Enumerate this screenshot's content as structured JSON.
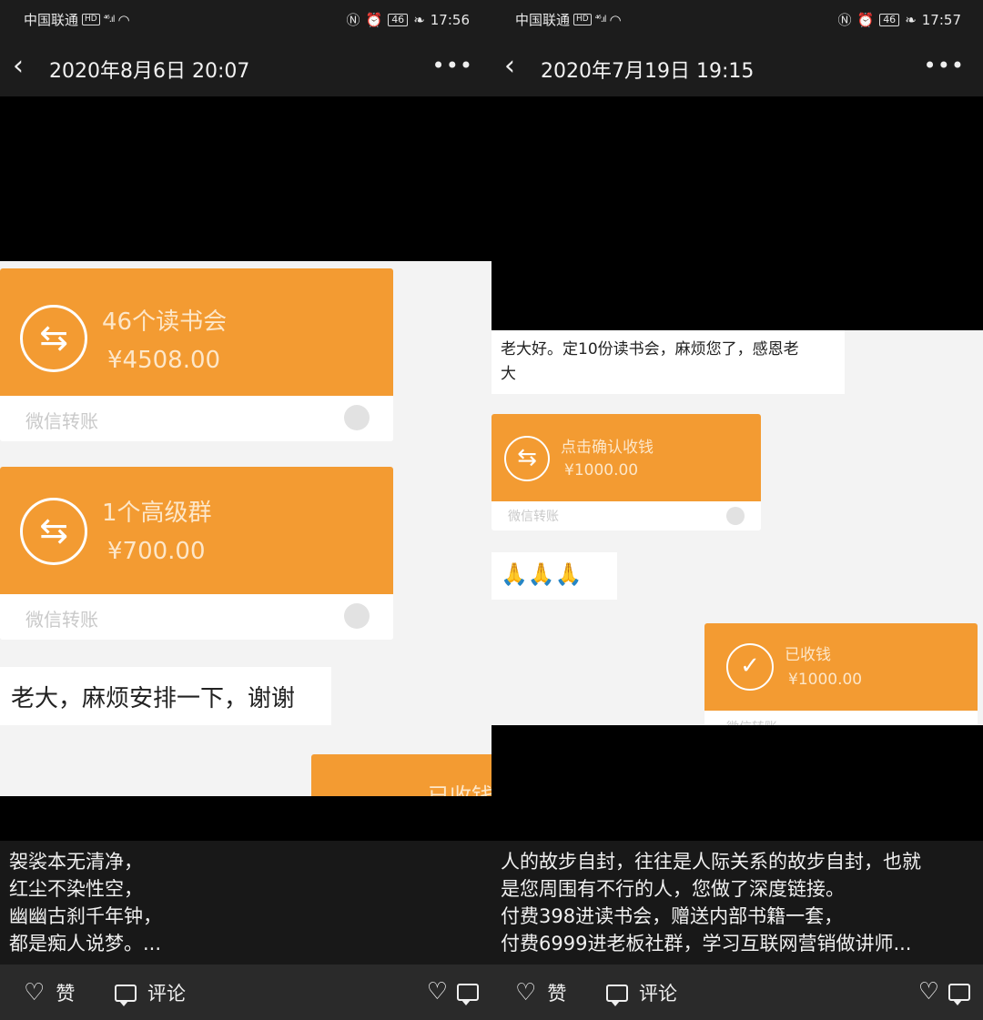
{
  "left": {
    "status": {
      "carrier": "中国联通",
      "hd": "HD",
      "network": "⁴⁶",
      "battery": "46",
      "time": "17:56"
    },
    "nav": {
      "title": "2020年8月6日 20:07"
    },
    "chat": {
      "transfer1": {
        "name": "46个读书会",
        "amount": "¥4508.00",
        "label": "微信转账"
      },
      "transfer2": {
        "name": "1个高级群",
        "amount": "¥700.00",
        "label": "微信转账"
      },
      "message": "老大，麻烦安排一下，谢谢",
      "partial_card": "已收钱"
    },
    "caption": [
      "袈裟本无清净，",
      "红尘不染性空，",
      "幽幽古刹千年钟，",
      "都是痴人说梦。..."
    ],
    "actions": {
      "like": "赞",
      "comment": "评论"
    }
  },
  "right": {
    "status": {
      "carrier": "中国联通",
      "hd": "HD",
      "network": "⁴⁶",
      "battery": "46",
      "time": "17:57"
    },
    "nav": {
      "title": "2020年7月19日 19:15"
    },
    "chat": {
      "message_line1": "老大好。定10份读书会，麻烦您了，感恩老",
      "message_line2": "大",
      "transfer1": {
        "name": "点击确认收钱",
        "amount": "¥1000.00",
        "label": "微信转账"
      },
      "emoji": "🙏🙏🙏",
      "transfer2": {
        "name": "已收钱",
        "amount": "¥1000.00",
        "label": "微信转账"
      }
    },
    "caption": [
      "人的故步自封，往往是人际关系的故步自封，也就",
      "是您周围有不行的人，您做了深度链接。",
      "付费398进读书会，赠送内部书籍一套，",
      "付费6999进老板社群，学习互联网营销做讲师..."
    ],
    "actions": {
      "like": "赞",
      "comment": "评论"
    }
  },
  "colors": {
    "transfer_orange": "#f39b32",
    "bar_dark": "#1c1c1c",
    "action_bar": "#2a2a2a"
  },
  "icons": {
    "back": "chevron-left-icon",
    "more": "more-dots-icon",
    "heart": "heart-icon",
    "comment": "comment-icon",
    "transfer": "swap-arrows-icon",
    "received": "check-circle-icon"
  }
}
